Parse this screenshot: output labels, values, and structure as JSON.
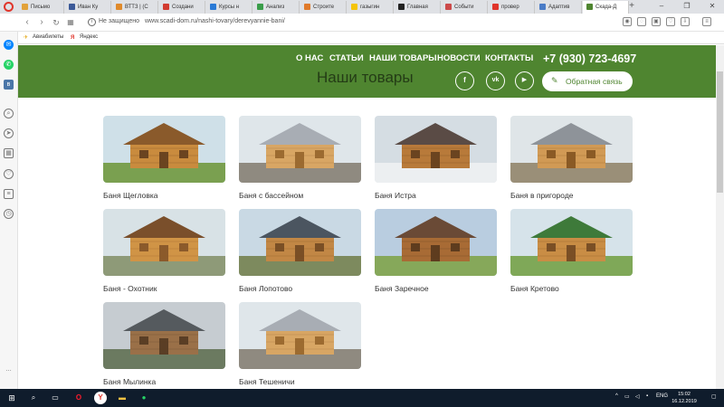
{
  "browser": {
    "tabs": [
      {
        "label": "Письмо",
        "color": "#e2a23a"
      },
      {
        "label": "Иван Ку",
        "color": "#3b5998"
      },
      {
        "label": "ВТТЗ | (С",
        "color": "#e08a2b"
      },
      {
        "label": "Создани",
        "color": "#d23b30"
      },
      {
        "label": "Курсы н",
        "color": "#2a7ad6"
      },
      {
        "label": "Анализ",
        "color": "#3a9d4a"
      },
      {
        "label": "Строите",
        "color": "#e07a2b"
      },
      {
        "label": "газыгин",
        "color": "#f5c40a"
      },
      {
        "label": "Главная",
        "color": "#222222"
      },
      {
        "label": "Событи",
        "color": "#cc4a4a"
      },
      {
        "label": "провер",
        "color": "#e0352b"
      },
      {
        "label": "Адаптив",
        "color": "#4a7cc7"
      },
      {
        "label": "Скада-Д",
        "color": "#4f8530"
      }
    ],
    "security_label": "Не защищено",
    "url": "www.scadi-dom.ru/nashi-tovary/derevyannie-bani/",
    "bookmarks": [
      "Авиабилеты",
      "Яндекс"
    ]
  },
  "site": {
    "menu": [
      "О НАС",
      "СТАТЬИ",
      "НАШИ ТОВАРЫ",
      "НОВОСТИ",
      "КОНТАКТЫ"
    ],
    "phone": "+7 (930) 723-4697",
    "page_title": "Наши товары",
    "social": [
      {
        "name": "facebook-icon",
        "glyph": "f"
      },
      {
        "name": "vk-icon",
        "glyph": "vk"
      },
      {
        "name": "youtube-icon",
        "glyph": "▶"
      }
    ],
    "feedback_label": "Обратная связь"
  },
  "products": [
    {
      "title": "Баня Щегловка",
      "scene": "porch"
    },
    {
      "title": "Баня с бассейном",
      "scene": "frame"
    },
    {
      "title": "Баня Истра",
      "scene": "winter"
    },
    {
      "title": "Баня в пригороде",
      "scene": "frame2"
    },
    {
      "title": "Баня - Охотник",
      "scene": "log"
    },
    {
      "title": "Баня Лопотово",
      "scene": "tall"
    },
    {
      "title": "Баня Заречное",
      "scene": "field"
    },
    {
      "title": "Баня Кретово",
      "scene": "green"
    },
    {
      "title": "Баня Мылинка",
      "scene": "grey"
    },
    {
      "title": "Баня Тешеничи",
      "scene": "frame"
    }
  ],
  "taskbar": {
    "lang": "ENG",
    "time": "15:02",
    "date": "16.12.2019"
  }
}
